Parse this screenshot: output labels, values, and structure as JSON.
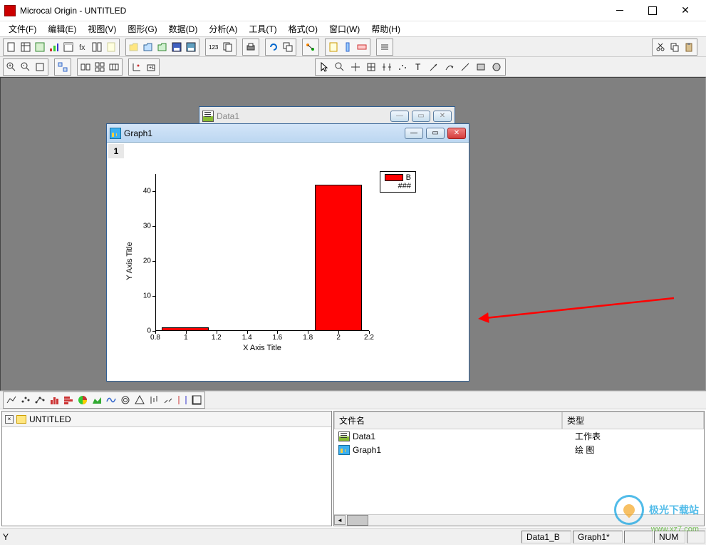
{
  "app": {
    "title": "Microcal Origin - UNTITLED"
  },
  "menu": [
    "文件(F)",
    "编辑(E)",
    "视图(V)",
    "图形(G)",
    "数据(D)",
    "分析(A)",
    "工具(T)",
    "格式(O)",
    "窗口(W)",
    "帮助(H)"
  ],
  "child_windows": {
    "data": {
      "title": "Data1"
    },
    "graph": {
      "title": "Graph1",
      "page": "1"
    }
  },
  "legend": {
    "series": "B",
    "subtext": "###"
  },
  "axis": {
    "ylabel": "Y Axis Title",
    "xlabel": "X Axis Title"
  },
  "project": {
    "root": "UNTITLED"
  },
  "file_list": {
    "headers": {
      "name": "文件名",
      "type": "类型"
    },
    "rows": [
      {
        "name": "Data1",
        "type": "工作表",
        "icon": "ws"
      },
      {
        "name": "Graph1",
        "type": "绘 图",
        "icon": "gr"
      }
    ]
  },
  "statusbar": {
    "left": "Y",
    "cells": [
      "Data1_B",
      "Graph1*",
      "",
      "NUM",
      ""
    ]
  },
  "watermark": {
    "line1": "极光下载站",
    "line2": "www.xz7.com"
  },
  "chart_data": {
    "type": "bar",
    "series_name": "B",
    "x": [
      1,
      2
    ],
    "values": [
      1,
      42
    ],
    "xlabel": "X Axis Title",
    "ylabel": "Y Axis Title",
    "xlim": [
      0.8,
      2.2
    ],
    "ylim": [
      0,
      45
    ],
    "xticks": [
      0.8,
      1.0,
      1.2,
      1.4,
      1.6,
      1.8,
      2.0,
      2.2
    ],
    "yticks": [
      0,
      10,
      20,
      30,
      40
    ]
  }
}
